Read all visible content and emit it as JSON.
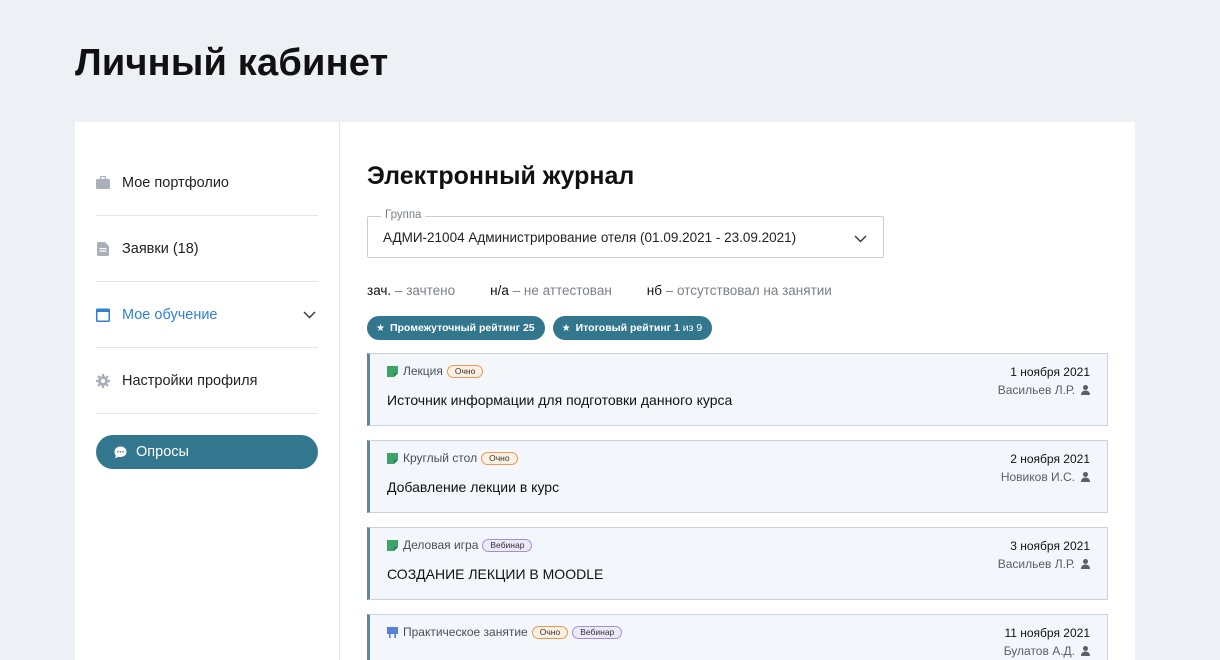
{
  "page": {
    "title": "Личный кабинет"
  },
  "sidebar": {
    "items": [
      {
        "label": "Мое портфолио",
        "icon": "briefcase-icon"
      },
      {
        "label": "Заявки (18)",
        "icon": "document-icon"
      },
      {
        "label": "Мое обучение",
        "icon": "calendar-icon",
        "active": true
      },
      {
        "label": "Настройки профиля",
        "icon": "gear-icon"
      }
    ],
    "poll_button": "Опросы"
  },
  "main": {
    "title": "Электронный журнал",
    "group": {
      "legend": "Группа",
      "value": "АДМИ-21004 Администрирование отеля (01.09.2021 - 23.09.2021)"
    },
    "abbreviations": [
      {
        "key": "зач.",
        "desc": " – зачтено"
      },
      {
        "key": "н/а",
        "desc": " – не аттестован"
      },
      {
        "key": "нб",
        "desc": " – отсутствовал на занятии"
      }
    ],
    "badges": {
      "interim": "Промежуточный рейтинг 25",
      "final_label": "Итоговый рейтинг 1",
      "final_suffix": "из 9"
    },
    "lessons": [
      {
        "type": "Лекция",
        "tags": [
          "Очно"
        ],
        "topic": "Источник информации для подготовки данного курса",
        "date": "1 ноября 2021",
        "teacher": "Васильев Л.Р."
      },
      {
        "type": "Круглый стол",
        "tags": [
          "Очно"
        ],
        "topic": "Добавление лекции в курс",
        "date": "2 ноября 2021",
        "teacher": "Новиков И.С."
      },
      {
        "type": "Деловая игра",
        "tags": [
          "Вебинар"
        ],
        "topic": "СОЗДАНИЕ ЛЕКЦИИ В MOODLE",
        "date": "3 ноября 2021",
        "teacher": "Васильев Л.Р."
      },
      {
        "type": "Практическое занятие",
        "tags": [
          "Очно",
          "Вебинар"
        ],
        "topic": "",
        "date": "11 ноября 2021",
        "teacher": "Булатов А.Д."
      }
    ]
  },
  "colors": {
    "accent": "#33778f",
    "active_link": "#2f7fd3",
    "tag_ochno": "#e59a55",
    "tag_webinar": "#a58fd4",
    "type_icon_green": "#3ea36b",
    "type_icon_blue": "#5b7fd6"
  }
}
